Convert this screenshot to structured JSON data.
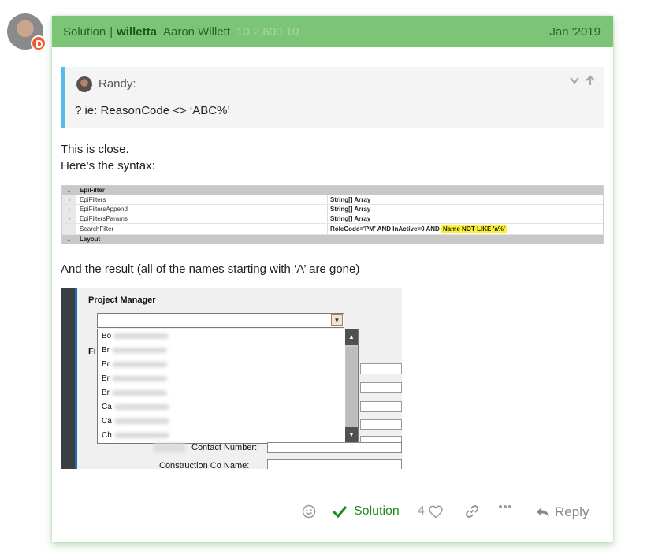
{
  "post": {
    "header": {
      "solution_label": "Solution",
      "separator": "|",
      "username": "willetta",
      "fullname": "Aaron Willett",
      "version": "10.2.600.10",
      "date": "Jan '2019"
    },
    "quote": {
      "author": "Randy:",
      "text": "? ie: ReasonCode <> ‘ABC%’"
    },
    "body": {
      "line1": "This is close.",
      "line2": "Here’s the syntax:",
      "line3": "And the result (all of the names starting with ‘A’ are gone)"
    },
    "grid_screenshot": {
      "section1": "EpiFilter",
      "section2": "Layout",
      "rows": [
        {
          "name": "EpiFilters",
          "value": "String[] Array"
        },
        {
          "name": "EpiFiltersAppend",
          "value": "String[] Array"
        },
        {
          "name": "EpiFiltersParams",
          "value": "String[] Array"
        },
        {
          "name": "SearchFilter",
          "value_plain": "RoleCode='PM' AND InActive=0 AND ",
          "value_highlight": "Name NOT LIKE 'a%'"
        }
      ]
    },
    "dropdown_screenshot": {
      "label": "Project Manager",
      "fi_label": "Fi",
      "items": [
        "Bo",
        "Br",
        "Br",
        "Br",
        "Br",
        "Ca",
        "Ca",
        "Ch"
      ],
      "contact_label": "Contact Number:",
      "construction_label": "Construction Co Name:"
    },
    "actions": {
      "solution": "Solution",
      "likes": "4",
      "reply": "Reply"
    }
  }
}
